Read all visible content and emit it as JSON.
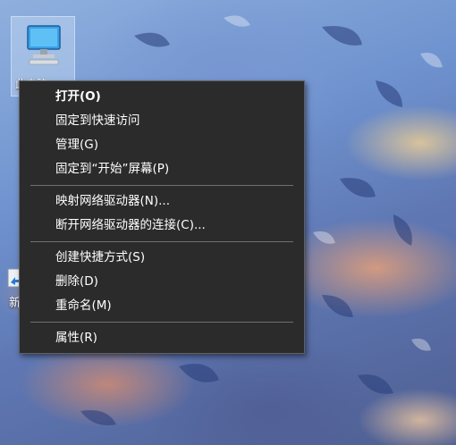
{
  "desktop": {
    "icons": [
      {
        "label": "此电脑",
        "icon": "computer-monitor-icon"
      },
      {
        "label": "新",
        "icon": "shortcut-icon"
      }
    ]
  },
  "context_menu": {
    "groups": [
      [
        {
          "label": "打开(O)",
          "bold": true
        },
        {
          "label": "固定到快速访问"
        },
        {
          "label": "管理(G)"
        },
        {
          "label": "固定到“开始”屏幕(P)"
        }
      ],
      [
        {
          "label": "映射网络驱动器(N)..."
        },
        {
          "label": "断开网络驱动器的连接(C)..."
        }
      ],
      [
        {
          "label": "创建快捷方式(S)"
        },
        {
          "label": "删除(D)"
        },
        {
          "label": "重命名(M)"
        }
      ],
      [
        {
          "label": "属性(R)"
        }
      ]
    ]
  },
  "colors": {
    "menu_background": "#2b2b2b",
    "menu_text": "#ffffff",
    "menu_separator": "#707070"
  }
}
